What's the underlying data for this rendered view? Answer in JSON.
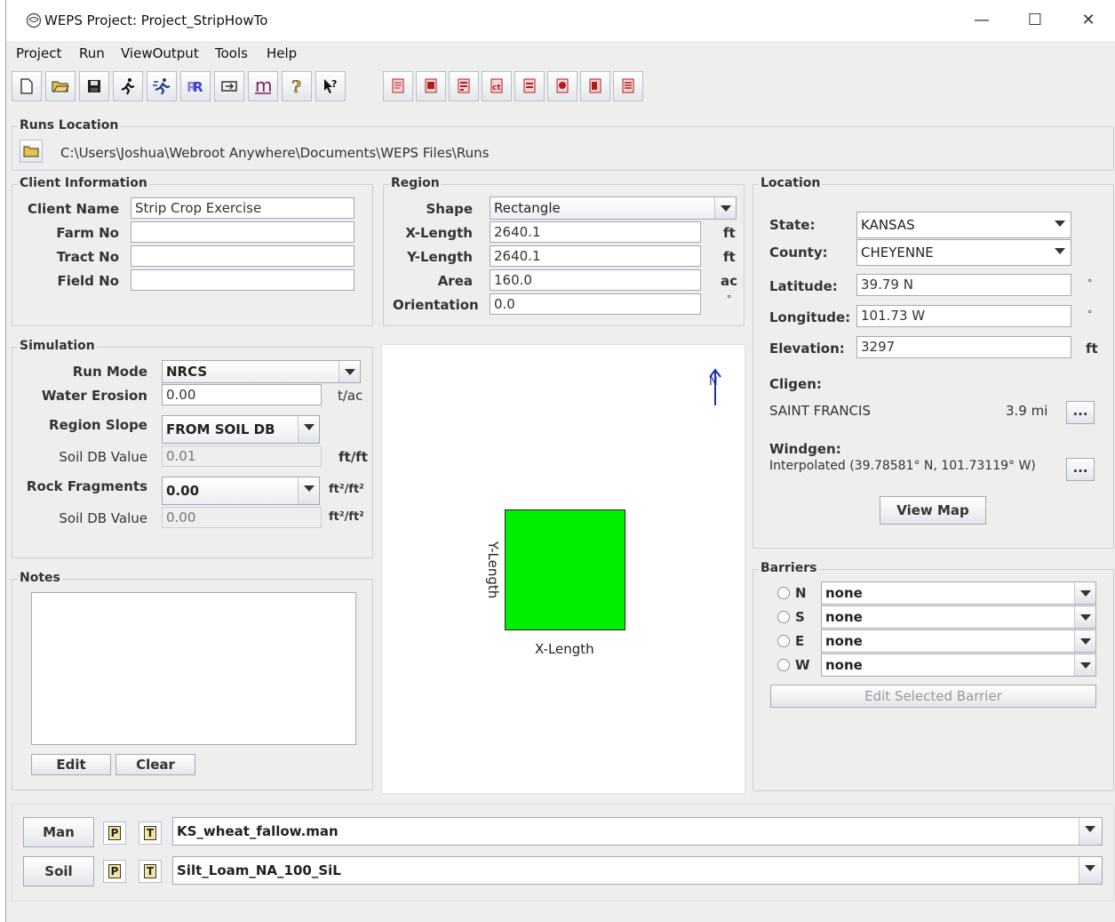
{
  "window": {
    "title": "WEPS Project: Project_StripHowTo",
    "minimize": "—",
    "maximize": "☐",
    "close": "✕"
  },
  "menu": [
    "Project",
    "Run",
    "ViewOutput",
    "Tools",
    "Help"
  ],
  "runs_location": {
    "title": "Runs Location",
    "path": "C:\\Users\\Joshua\\Webroot Anywhere\\Documents\\WEPS Files\\Runs"
  },
  "client": {
    "title": "Client Information",
    "client_name_label": "Client Name",
    "client_name_value": "Strip Crop Exercise",
    "farm_label": "Farm No",
    "farm_value": "",
    "tract_label": "Tract No",
    "tract_value": "",
    "field_label": "Field No",
    "field_value": ""
  },
  "region": {
    "title": "Region",
    "shape_label": "Shape",
    "shape_value": "Rectangle",
    "xlen_label": "X-Length",
    "xlen_value": "2640.1",
    "xlen_unit": "ft",
    "ylen_label": "Y-Length",
    "ylen_value": "2640.1",
    "ylen_unit": "ft",
    "area_label": "Area",
    "area_value": "160.0",
    "area_unit": "ac",
    "orient_label": "Orientation",
    "orient_value": "0.0",
    "orient_unit": "°"
  },
  "location": {
    "title": "Location",
    "state_label": "State:",
    "state_value": "KANSAS",
    "county_label": "County:",
    "county_value": "CHEYENNE",
    "lat_label": "Latitude:",
    "lat_value": "39.79 N",
    "lat_unit": "°",
    "lon_label": "Longitude:",
    "lon_value": "101.73 W",
    "lon_unit": "°",
    "elev_label": "Elevation:",
    "elev_value": "3297",
    "elev_unit": "ft",
    "cligen_label": "Cligen:",
    "cligen_station": "SAINT FRANCIS",
    "cligen_dist": "3.9  mi",
    "windgen_label": "Windgen:",
    "windgen_value": "Interpolated (39.78581° N, 101.73119° W)",
    "more_label": "...",
    "view_map_label": "View Map"
  },
  "simulation": {
    "title": "Simulation",
    "run_mode_label": "Run Mode",
    "run_mode_value": "NRCS",
    "water_erosion_label": "Water Erosion",
    "water_erosion_value": "0.00",
    "water_erosion_unit": "t/ac",
    "region_slope_label": "Region Slope",
    "region_slope_value": "FROM SOIL DB",
    "soil_db_label": "Soil DB Value",
    "soil_db_slope_value": "0.01",
    "slope_unit": "ft/ft",
    "rock_label": "Rock Fragments",
    "rock_value": "0.00",
    "rock_unit": "ft²/ft²",
    "soil_db_rock_value": "0.00"
  },
  "notes": {
    "title": "Notes",
    "text": "",
    "edit_label": "Edit",
    "clear_label": "Clear"
  },
  "field_view": {
    "north_label": "N",
    "x_label": "X-Length",
    "y_label": "Y-Length",
    "field_color": "#00ee00"
  },
  "barriers": {
    "title": "Barriers",
    "items": [
      {
        "dir": "N",
        "value": "none"
      },
      {
        "dir": "S",
        "value": "none"
      },
      {
        "dir": "E",
        "value": "none"
      },
      {
        "dir": "W",
        "value": "none"
      }
    ],
    "edit_label": "Edit Selected Barrier"
  },
  "files": {
    "man_label": "Man",
    "man_value": "KS_wheat_fallow.man",
    "soil_label": "Soil",
    "soil_value": "Silt_Loam_NA_100_SiL",
    "p_label": "P",
    "t_label": "T"
  }
}
